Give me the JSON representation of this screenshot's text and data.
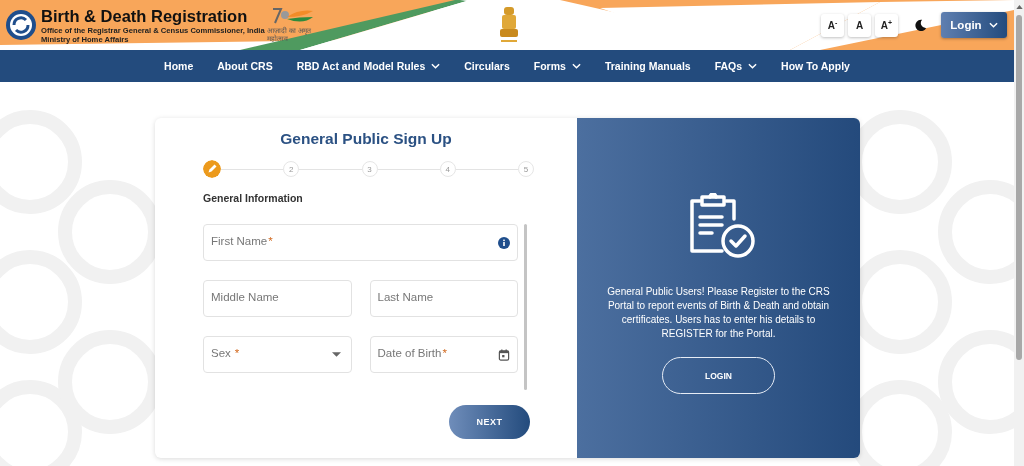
{
  "header": {
    "title": "Birth & Death Registration",
    "subtitle": "Office of the Registrar General & Census Commissioner, India",
    "ministry": "Ministry of Home Affairs",
    "jubilee_logo_text": "आज़ादी का अमृत महोत्सव",
    "font_buttons": [
      {
        "label": "A",
        "mark": "-"
      },
      {
        "label": "A"
      },
      {
        "label": "A",
        "mark": "+"
      }
    ],
    "login_button": "Login"
  },
  "nav": [
    {
      "label": "Home",
      "dropdown": false
    },
    {
      "label": "About CRS",
      "dropdown": false
    },
    {
      "label": "RBD Act and Model Rules",
      "dropdown": true
    },
    {
      "label": "Circulars",
      "dropdown": false
    },
    {
      "label": "Forms",
      "dropdown": true
    },
    {
      "label": "Training Manuals",
      "dropdown": false
    },
    {
      "label": "FAQs",
      "dropdown": true
    },
    {
      "label": "How To Apply",
      "dropdown": false
    }
  ],
  "form": {
    "title": "General Public Sign Up",
    "steps": [
      {
        "active": true
      },
      {
        "label": "2",
        "active": false
      },
      {
        "label": "3",
        "active": false
      },
      {
        "label": "4",
        "active": false
      },
      {
        "label": "5",
        "active": false
      }
    ],
    "section": "General Information",
    "rows": [
      [
        {
          "kind": "text",
          "placeholder": "First Name",
          "required_mark": "*",
          "info": true
        }
      ],
      [
        {
          "kind": "text",
          "placeholder": "Middle Name",
          "info": false
        },
        {
          "kind": "text",
          "placeholder": "Last Name",
          "info": false
        }
      ],
      [
        {
          "kind": "select",
          "placeholder": "Sex",
          "required_mark": "*",
          "info": false
        },
        {
          "kind": "date",
          "placeholder": "Date of Birth",
          "required_mark": "*",
          "info": false
        }
      ]
    ],
    "next_button": "NEXT"
  },
  "side_panel": {
    "message": "General Public Users! Please Register to the CRS Portal to report events of Birth & Death and obtain certificates. Users has to enter his details to REGISTER for the Portal.",
    "login_button": "LOGIN"
  }
}
